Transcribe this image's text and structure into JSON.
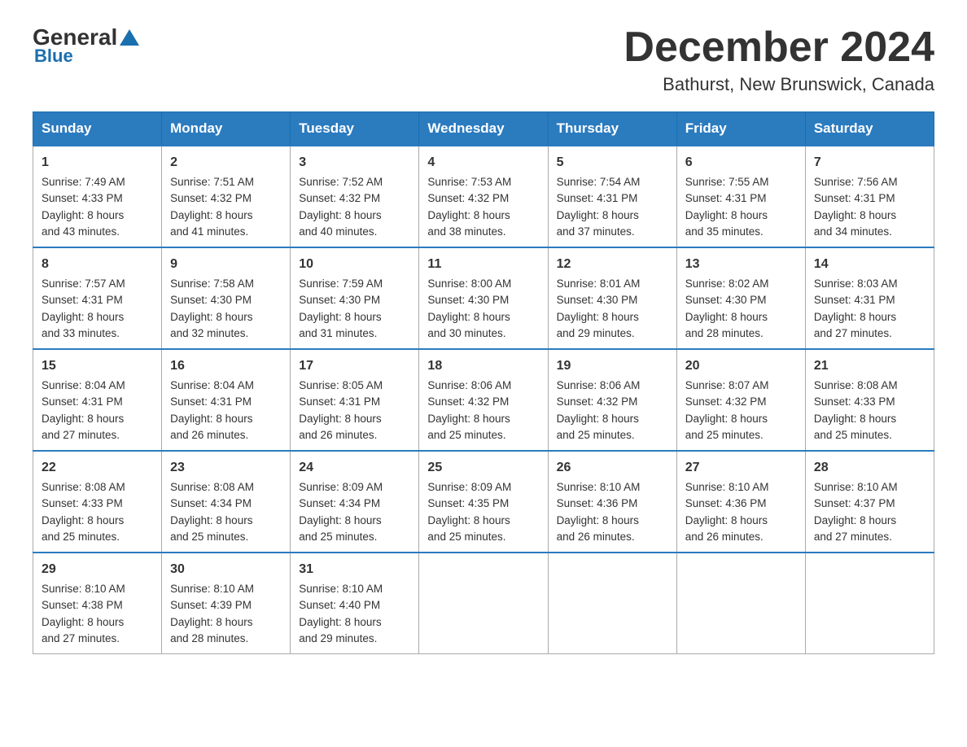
{
  "header": {
    "logo_general": "General",
    "logo_blue": "Blue",
    "month_title": "December 2024",
    "location": "Bathurst, New Brunswick, Canada"
  },
  "days_of_week": [
    "Sunday",
    "Monday",
    "Tuesday",
    "Wednesday",
    "Thursday",
    "Friday",
    "Saturday"
  ],
  "weeks": [
    [
      {
        "num": "1",
        "sunrise": "7:49 AM",
        "sunset": "4:33 PM",
        "daylight": "8 hours and 43 minutes."
      },
      {
        "num": "2",
        "sunrise": "7:51 AM",
        "sunset": "4:32 PM",
        "daylight": "8 hours and 41 minutes."
      },
      {
        "num": "3",
        "sunrise": "7:52 AM",
        "sunset": "4:32 PM",
        "daylight": "8 hours and 40 minutes."
      },
      {
        "num": "4",
        "sunrise": "7:53 AM",
        "sunset": "4:32 PM",
        "daylight": "8 hours and 38 minutes."
      },
      {
        "num": "5",
        "sunrise": "7:54 AM",
        "sunset": "4:31 PM",
        "daylight": "8 hours and 37 minutes."
      },
      {
        "num": "6",
        "sunrise": "7:55 AM",
        "sunset": "4:31 PM",
        "daylight": "8 hours and 35 minutes."
      },
      {
        "num": "7",
        "sunrise": "7:56 AM",
        "sunset": "4:31 PM",
        "daylight": "8 hours and 34 minutes."
      }
    ],
    [
      {
        "num": "8",
        "sunrise": "7:57 AM",
        "sunset": "4:31 PM",
        "daylight": "8 hours and 33 minutes."
      },
      {
        "num": "9",
        "sunrise": "7:58 AM",
        "sunset": "4:30 PM",
        "daylight": "8 hours and 32 minutes."
      },
      {
        "num": "10",
        "sunrise": "7:59 AM",
        "sunset": "4:30 PM",
        "daylight": "8 hours and 31 minutes."
      },
      {
        "num": "11",
        "sunrise": "8:00 AM",
        "sunset": "4:30 PM",
        "daylight": "8 hours and 30 minutes."
      },
      {
        "num": "12",
        "sunrise": "8:01 AM",
        "sunset": "4:30 PM",
        "daylight": "8 hours and 29 minutes."
      },
      {
        "num": "13",
        "sunrise": "8:02 AM",
        "sunset": "4:30 PM",
        "daylight": "8 hours and 28 minutes."
      },
      {
        "num": "14",
        "sunrise": "8:03 AM",
        "sunset": "4:31 PM",
        "daylight": "8 hours and 27 minutes."
      }
    ],
    [
      {
        "num": "15",
        "sunrise": "8:04 AM",
        "sunset": "4:31 PM",
        "daylight": "8 hours and 27 minutes."
      },
      {
        "num": "16",
        "sunrise": "8:04 AM",
        "sunset": "4:31 PM",
        "daylight": "8 hours and 26 minutes."
      },
      {
        "num": "17",
        "sunrise": "8:05 AM",
        "sunset": "4:31 PM",
        "daylight": "8 hours and 26 minutes."
      },
      {
        "num": "18",
        "sunrise": "8:06 AM",
        "sunset": "4:32 PM",
        "daylight": "8 hours and 25 minutes."
      },
      {
        "num": "19",
        "sunrise": "8:06 AM",
        "sunset": "4:32 PM",
        "daylight": "8 hours and 25 minutes."
      },
      {
        "num": "20",
        "sunrise": "8:07 AM",
        "sunset": "4:32 PM",
        "daylight": "8 hours and 25 minutes."
      },
      {
        "num": "21",
        "sunrise": "8:08 AM",
        "sunset": "4:33 PM",
        "daylight": "8 hours and 25 minutes."
      }
    ],
    [
      {
        "num": "22",
        "sunrise": "8:08 AM",
        "sunset": "4:33 PM",
        "daylight": "8 hours and 25 minutes."
      },
      {
        "num": "23",
        "sunrise": "8:08 AM",
        "sunset": "4:34 PM",
        "daylight": "8 hours and 25 minutes."
      },
      {
        "num": "24",
        "sunrise": "8:09 AM",
        "sunset": "4:34 PM",
        "daylight": "8 hours and 25 minutes."
      },
      {
        "num": "25",
        "sunrise": "8:09 AM",
        "sunset": "4:35 PM",
        "daylight": "8 hours and 25 minutes."
      },
      {
        "num": "26",
        "sunrise": "8:10 AM",
        "sunset": "4:36 PM",
        "daylight": "8 hours and 26 minutes."
      },
      {
        "num": "27",
        "sunrise": "8:10 AM",
        "sunset": "4:36 PM",
        "daylight": "8 hours and 26 minutes."
      },
      {
        "num": "28",
        "sunrise": "8:10 AM",
        "sunset": "4:37 PM",
        "daylight": "8 hours and 27 minutes."
      }
    ],
    [
      {
        "num": "29",
        "sunrise": "8:10 AM",
        "sunset": "4:38 PM",
        "daylight": "8 hours and 27 minutes."
      },
      {
        "num": "30",
        "sunrise": "8:10 AM",
        "sunset": "4:39 PM",
        "daylight": "8 hours and 28 minutes."
      },
      {
        "num": "31",
        "sunrise": "8:10 AM",
        "sunset": "4:40 PM",
        "daylight": "8 hours and 29 minutes."
      },
      null,
      null,
      null,
      null
    ]
  ],
  "labels": {
    "sunrise": "Sunrise:",
    "sunset": "Sunset:",
    "daylight": "Daylight:"
  }
}
